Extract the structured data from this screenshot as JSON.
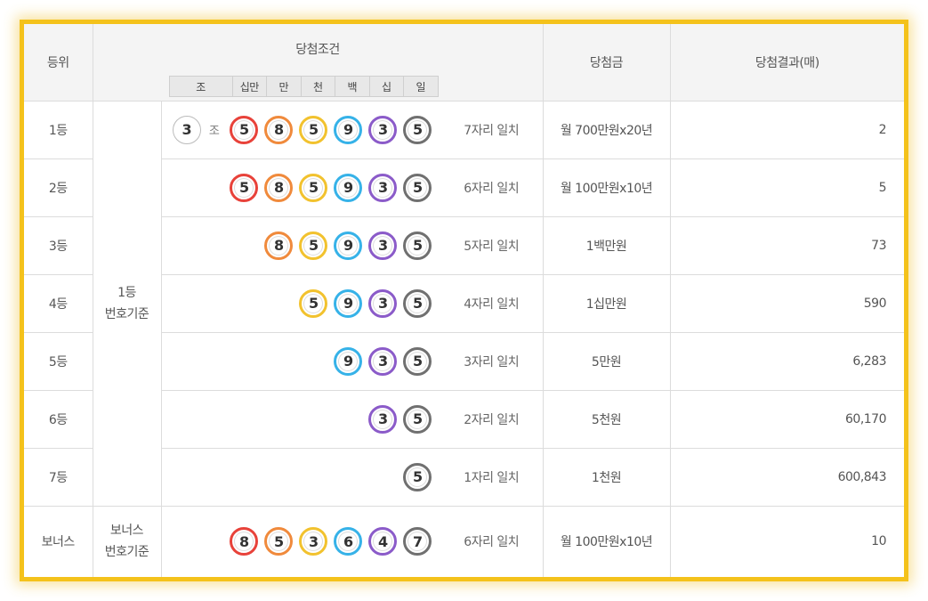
{
  "header": {
    "rank": "등위",
    "condition": "당첨조건",
    "prize": "당첨금",
    "count": "당첨결과(매)",
    "units": [
      "조",
      "십만",
      "만",
      "천",
      "백",
      "십",
      "일"
    ]
  },
  "ball_colors": {
    "red": "#e8423a",
    "orange": "#f08a3c",
    "yellow": "#f2c22e",
    "blue": "#36b2e8",
    "purple": "#8b5bc9",
    "gray": "#707070"
  },
  "rows": [
    {
      "rank": "1등",
      "jo": "3",
      "jo_label": "조",
      "balls": [
        {
          "n": "5",
          "c": "red"
        },
        {
          "n": "8",
          "c": "orange"
        },
        {
          "n": "5",
          "c": "yellow"
        },
        {
          "n": "9",
          "c": "blue"
        },
        {
          "n": "3",
          "c": "purple"
        },
        {
          "n": "5",
          "c": "gray"
        }
      ],
      "match": "7자리 일치",
      "prize": "월 700만원x20년",
      "count": "2"
    },
    {
      "rank": "2등",
      "balls": [
        {
          "n": "5",
          "c": "red"
        },
        {
          "n": "8",
          "c": "orange"
        },
        {
          "n": "5",
          "c": "yellow"
        },
        {
          "n": "9",
          "c": "blue"
        },
        {
          "n": "3",
          "c": "purple"
        },
        {
          "n": "5",
          "c": "gray"
        }
      ],
      "match": "6자리 일치",
      "prize": "월 100만원x10년",
      "count": "5"
    },
    {
      "rank": "3등",
      "balls": [
        {
          "n": "8",
          "c": "orange"
        },
        {
          "n": "5",
          "c": "yellow"
        },
        {
          "n": "9",
          "c": "blue"
        },
        {
          "n": "3",
          "c": "purple"
        },
        {
          "n": "5",
          "c": "gray"
        }
      ],
      "match": "5자리 일치",
      "prize": "1백만원",
      "count": "73"
    },
    {
      "rank": "4등",
      "balls": [
        {
          "n": "5",
          "c": "yellow"
        },
        {
          "n": "9",
          "c": "blue"
        },
        {
          "n": "3",
          "c": "purple"
        },
        {
          "n": "5",
          "c": "gray"
        }
      ],
      "match": "4자리 일치",
      "prize": "1십만원",
      "count": "590"
    },
    {
      "rank": "5등",
      "balls": [
        {
          "n": "9",
          "c": "blue"
        },
        {
          "n": "3",
          "c": "purple"
        },
        {
          "n": "5",
          "c": "gray"
        }
      ],
      "match": "3자리 일치",
      "prize": "5만원",
      "count": "6,283"
    },
    {
      "rank": "6등",
      "balls": [
        {
          "n": "3",
          "c": "purple"
        },
        {
          "n": "5",
          "c": "gray"
        }
      ],
      "match": "2자리 일치",
      "prize": "5천원",
      "count": "60,170"
    },
    {
      "rank": "7등",
      "balls": [
        {
          "n": "5",
          "c": "gray"
        }
      ],
      "match": "1자리 일치",
      "prize": "1천원",
      "count": "600,843"
    }
  ],
  "basis_main": [
    "1등",
    "번호기준"
  ],
  "bonus": {
    "rank": "보너스",
    "basis": [
      "보너스",
      "번호기준"
    ],
    "balls": [
      {
        "n": "8",
        "c": "red"
      },
      {
        "n": "5",
        "c": "orange"
      },
      {
        "n": "3",
        "c": "yellow"
      },
      {
        "n": "6",
        "c": "blue"
      },
      {
        "n": "4",
        "c": "purple"
      },
      {
        "n": "7",
        "c": "gray"
      }
    ],
    "match": "6자리 일치",
    "prize": "월 100만원x10년",
    "count": "10"
  }
}
